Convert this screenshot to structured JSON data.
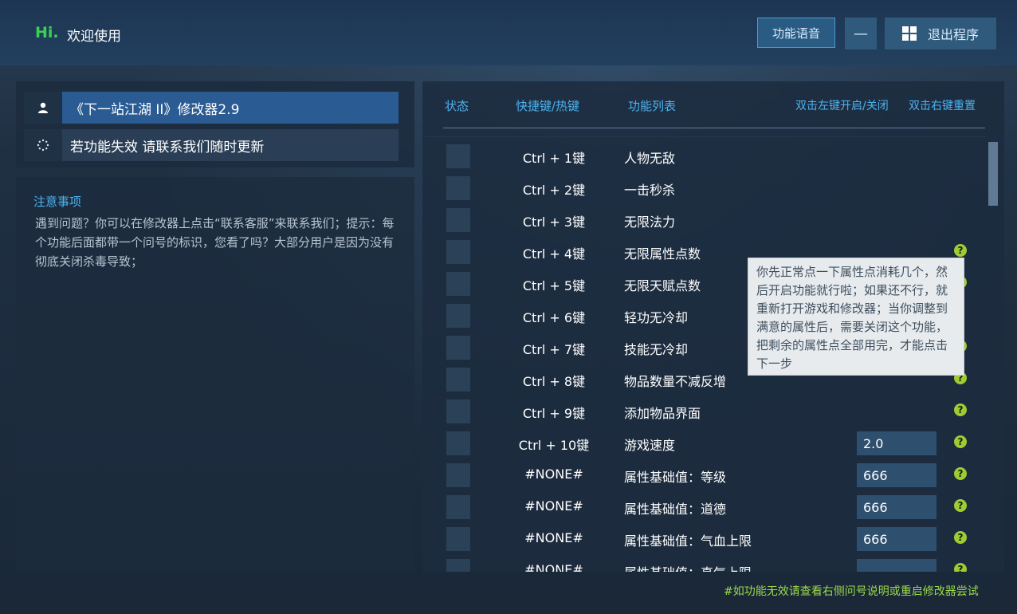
{
  "header": {
    "greeting": "Hi.",
    "welcome": "欢迎使用",
    "voice_button": "功能语音",
    "minimize_button": "—",
    "exit_button": "退出程序"
  },
  "left": {
    "title_item": "《下一站江湖 II》修改器2.9",
    "notice_item": "若功能失效 请联系我们随时更新",
    "notes_title": "注意事项",
    "notes_body": "遇到问题？你可以在修改器上点击“联系客服”来联系我们；提示：每个功能后面都带一个问号的标识，您看了吗？大部分用户是因为没有彻底关闭杀毒导致；"
  },
  "table": {
    "headers": {
      "status": "状态",
      "hotkey": "快捷键/热键",
      "function": "功能列表",
      "double_left": "双击左键开启/关闭",
      "double_right": "双击右键重置"
    },
    "rows": [
      {
        "hotkey": "Ctrl + 1键",
        "function": "人物无敌",
        "value": "",
        "help": false
      },
      {
        "hotkey": "Ctrl + 2键",
        "function": "一击秒杀",
        "value": "",
        "help": false
      },
      {
        "hotkey": "Ctrl + 3键",
        "function": "无限法力",
        "value": "",
        "help": false
      },
      {
        "hotkey": "Ctrl + 4键",
        "function": "无限属性点数",
        "value": "",
        "help": true
      },
      {
        "hotkey": "Ctrl + 5键",
        "function": "无限天赋点数",
        "value": "",
        "help": true
      },
      {
        "hotkey": "Ctrl + 6键",
        "function": "轻功无冷却",
        "value": "",
        "help": false
      },
      {
        "hotkey": "Ctrl + 7键",
        "function": "技能无冷却",
        "value": "",
        "help": true
      },
      {
        "hotkey": "Ctrl + 8键",
        "function": "物品数量不减反增",
        "value": "",
        "help": true
      },
      {
        "hotkey": "Ctrl + 9键",
        "function": "添加物品界面",
        "value": "",
        "help": true
      },
      {
        "hotkey": "Ctrl + 10键",
        "function": "游戏速度",
        "value": "2.0",
        "help": true
      },
      {
        "hotkey": "#NONE#",
        "function": "属性基础值：等级",
        "value": "666",
        "help": true
      },
      {
        "hotkey": "#NONE#",
        "function": "属性基础值：道德",
        "value": "666",
        "help": true
      },
      {
        "hotkey": "#NONE#",
        "function": "属性基础值：气血上限",
        "value": "666",
        "help": true
      },
      {
        "hotkey": "#NONE#",
        "function": "属性基础值：真气上限",
        "value": "",
        "help": true
      }
    ],
    "help_glyph": "?"
  },
  "tooltip": "你先正常点一下属性点消耗几个，然后开启功能就行啦；如果还不行，就重新打开游戏和修改器；当你调整到满意的属性后，需要关闭这个功能，把剩余的属性点全部用完，才能点击下一步",
  "footer": "#如功能无效请查看右侧问号说明或重启修改器尝试",
  "icons": {
    "user": "user-icon",
    "spinner": "loading-icon",
    "windows": "windows-icon"
  },
  "colors": {
    "accent": "#4cb2f0",
    "greeting": "#39d153",
    "help": "#a2cb32",
    "footer": "#9bd94a"
  }
}
